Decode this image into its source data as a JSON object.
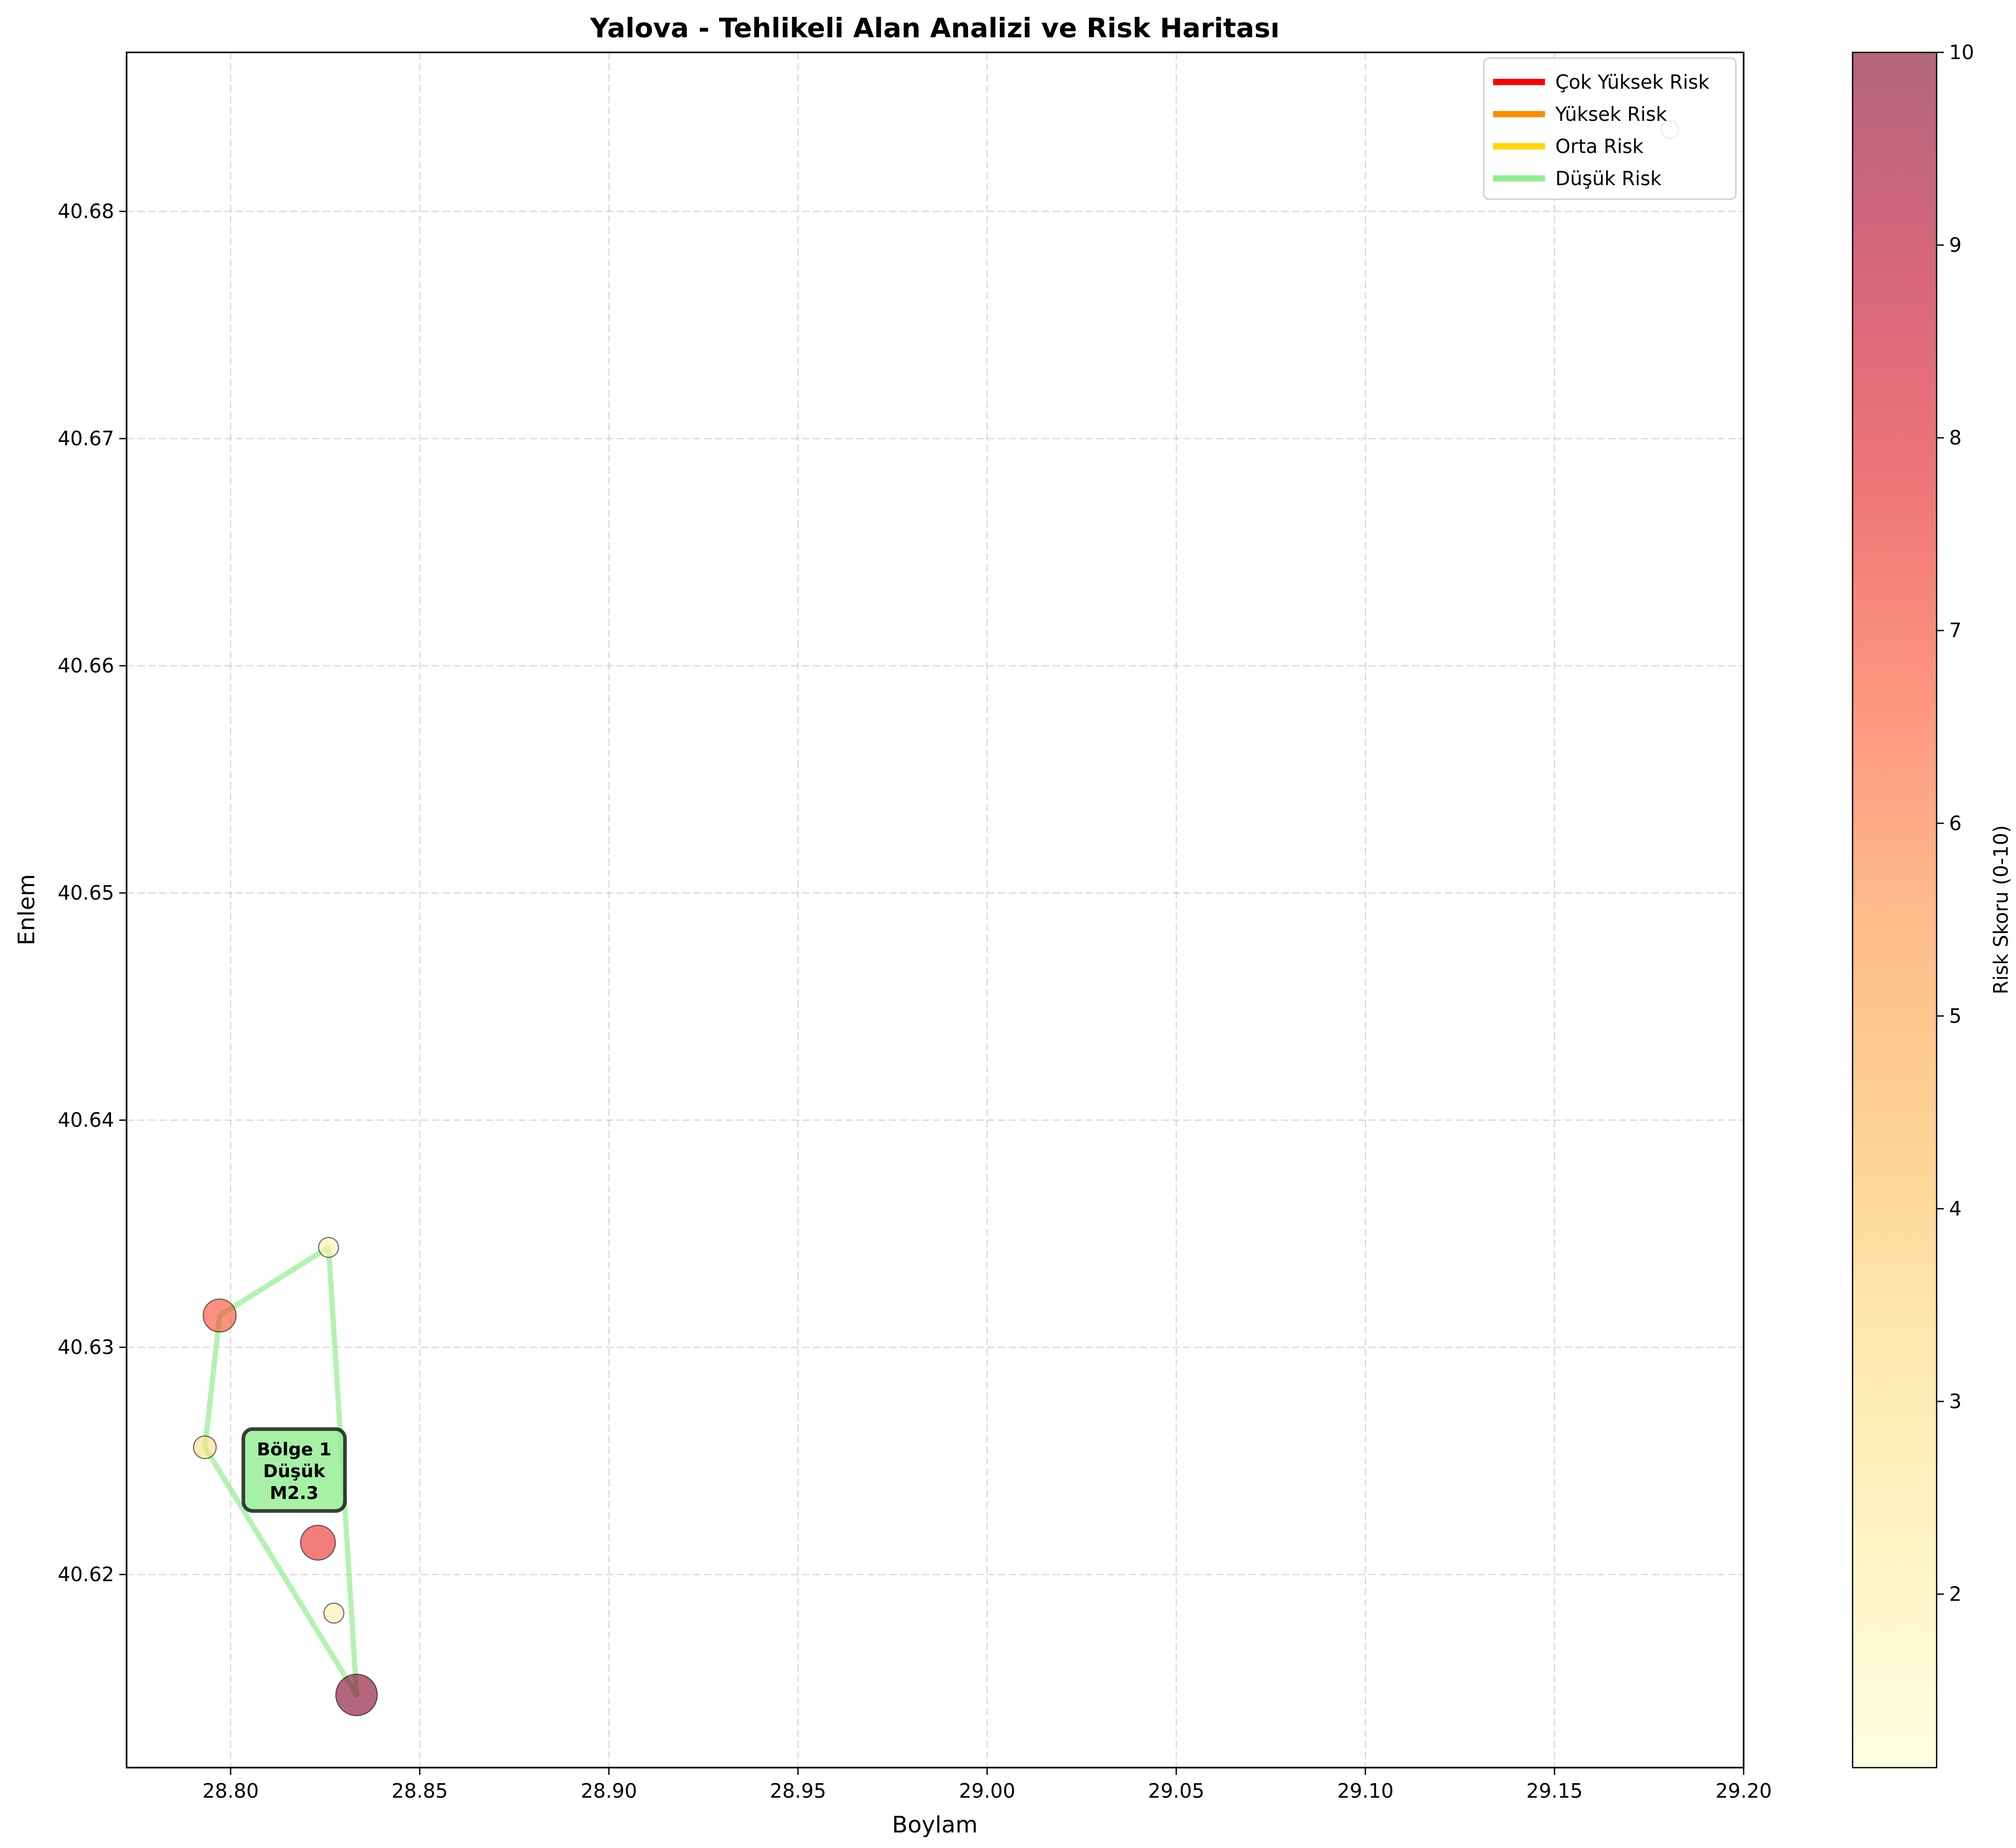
{
  "chart_data": {
    "type": "scatter",
    "title": "Yalova - Tehlikeli Alan Analizi ve Risk Haritası",
    "xlabel": "Boylam",
    "ylabel": "Enlem",
    "xlim": [
      28.7725,
      29.2
    ],
    "ylim": [
      40.6115,
      40.687
    ],
    "x_ticks": [
      {
        "value": 28.8,
        "label": "28.80"
      },
      {
        "value": 28.85,
        "label": "28.85"
      },
      {
        "value": 28.9,
        "label": "28.90"
      },
      {
        "value": 28.95,
        "label": "28.95"
      },
      {
        "value": 29.0,
        "label": "29.00"
      },
      {
        "value": 29.05,
        "label": "29.05"
      },
      {
        "value": 29.1,
        "label": "29.10"
      },
      {
        "value": 29.15,
        "label": "29.15"
      },
      {
        "value": 29.2,
        "label": "29.20"
      }
    ],
    "y_ticks": [
      {
        "value": 40.62,
        "label": "40.62"
      },
      {
        "value": 40.63,
        "label": "40.63"
      },
      {
        "value": 40.64,
        "label": "40.64"
      },
      {
        "value": 40.65,
        "label": "40.65"
      },
      {
        "value": 40.66,
        "label": "40.66"
      },
      {
        "value": 40.67,
        "label": "40.67"
      },
      {
        "value": 40.68,
        "label": "40.68"
      }
    ],
    "grid": true,
    "points": [
      {
        "x": 28.7932,
        "y": 40.6256,
        "risk": 3.0
      },
      {
        "x": 28.7971,
        "y": 40.6314,
        "risk": 6.8
      },
      {
        "x": 28.8259,
        "y": 40.6344,
        "risk": 2.0
      },
      {
        "x": 28.8231,
        "y": 40.6214,
        "risk": 7.5
      },
      {
        "x": 28.8273,
        "y": 40.6183,
        "risk": 2.0
      },
      {
        "x": 28.8333,
        "y": 40.6147,
        "risk": 10.0
      },
      {
        "x": 29.1805,
        "y": 40.6836,
        "risk": 1.1
      }
    ],
    "zones": [
      {
        "category": "Düşük",
        "color": "#90ee90",
        "polygon": [
          [
            28.8333,
            40.6147
          ],
          [
            28.7932,
            40.6256
          ],
          [
            28.7971,
            40.6314
          ],
          [
            28.8259,
            40.6344
          ],
          [
            28.8333,
            40.6147
          ]
        ],
        "annotation": {
          "x": 28.8168,
          "y": 40.6246,
          "lines": [
            "Bölge 1",
            "Düşük",
            "M2.3"
          ]
        }
      }
    ],
    "legend": {
      "placement": "top-right",
      "entries": [
        {
          "label": "Çok Yüksek Risk",
          "color": "#ff0000"
        },
        {
          "label": "Yüksek Risk",
          "color": "#ff8c00"
        },
        {
          "label": "Orta Risk",
          "color": "#ffd700"
        },
        {
          "label": "Düşük Risk",
          "color": "#90ee90"
        }
      ]
    },
    "colorbar": {
      "label": "Risk Skoru (0-10)",
      "range": [
        1.1,
        10
      ],
      "ticks": [
        2,
        3,
        4,
        5,
        6,
        7,
        8,
        9,
        10
      ],
      "colormap": "YlOrRd",
      "alpha": 0.6
    }
  }
}
